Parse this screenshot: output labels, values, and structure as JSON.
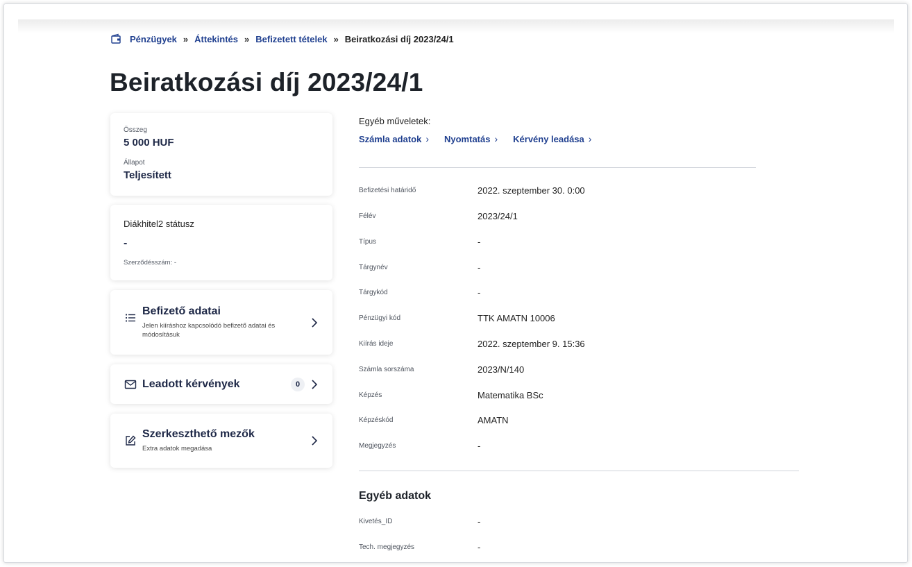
{
  "breadcrumb": {
    "items": [
      "Pénzügyek",
      "Áttekintés",
      "Befizetett tételek"
    ],
    "separator": "»",
    "current": "Beiratkozási díj 2023/24/1"
  },
  "page_title": "Beiratkozási díj 2023/24/1",
  "summary": {
    "amount_label": "Összeg",
    "amount_value": "5 000 HUF",
    "status_label": "Állapot",
    "status_value": "Teljesített"
  },
  "loan": {
    "title": "Diákhitel2 státusz",
    "value": "-",
    "contract_text": "Szerződésszám: -"
  },
  "payer_card": {
    "title": "Befizető adatai",
    "subtitle": "Jelen kiíráshoz kapcsolódó befizető adatai és módosításuk"
  },
  "requests_card": {
    "title": "Leadott kérvények",
    "count": "0"
  },
  "fields_card": {
    "title": "Szerkeszthető mezők",
    "subtitle": "Extra adatok megadása"
  },
  "other_ops": {
    "label": "Egyéb műveletek:",
    "links": [
      "Számla adatok",
      "Nyomtatás",
      "Kérvény leadása"
    ]
  },
  "details": [
    {
      "label": "Befizetési határidő",
      "value": "2022. szeptember 30. 0:00"
    },
    {
      "label": "Félév",
      "value": "2023/24/1"
    },
    {
      "label": "Típus",
      "value": "-"
    },
    {
      "label": "Tárgynév",
      "value": "-"
    },
    {
      "label": "Tárgykód",
      "value": "-"
    },
    {
      "label": "Pénzügyi kód",
      "value": "TTK AMATN 10006"
    },
    {
      "label": "Kiírás ideje",
      "value": "2022. szeptember 9. 15:36"
    },
    {
      "label": "Számla sorszáma",
      "value": "2023/N/140"
    },
    {
      "label": "Képzés",
      "value": "Matematika BSc"
    },
    {
      "label": "Képzéskód",
      "value": "AMATN"
    },
    {
      "label": "Megjegyzés",
      "value": "-"
    }
  ],
  "other_data": {
    "title": "Egyéb adatok",
    "rows": [
      {
        "label": "Kivetés_ID",
        "value": "-"
      },
      {
        "label": "Tech. megjegyzés",
        "value": "-"
      }
    ]
  },
  "icons": {
    "home": "wallet-icon",
    "payer": "list-icon",
    "requests": "envelope-icon",
    "fields": "edit-icon",
    "chevron": "chevron-right-icon"
  },
  "colors": {
    "link": "#1f3f8f",
    "title": "#1d2229",
    "card_title": "#1d2746"
  }
}
